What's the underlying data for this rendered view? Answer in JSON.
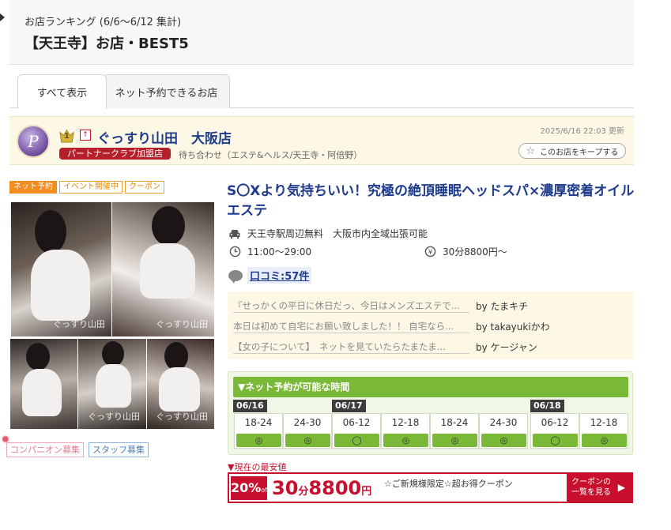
{
  "header": {
    "subtitle": "お店ランキング (6/6～6/12 集計)",
    "title": "【天王寺】お店・BEST5"
  },
  "tabs": [
    {
      "label": "すべて表示",
      "active": true
    },
    {
      "label": "ネット予約できるお店",
      "active": false
    }
  ],
  "shop": {
    "rank": "1",
    "up_mark": "↑",
    "name": "ぐっすり山田　大阪店",
    "partner_label": "パートナークラブ加盟店",
    "category": "待ち合わせ（エステ&ヘルス/天王寺・阿倍野）",
    "updated": "2025/6/16 22:03 更新",
    "keep_label": "このお店をキープする",
    "logo_text": "P",
    "tags": [
      "ネット予約",
      "イベント開催中",
      "クーポン"
    ],
    "watermark": "ぐっすり山田",
    "catch": "S〇Xより気持ちいい！究極の絶頂睡眠ヘッドスパ×濃厚密着オイルエステ",
    "access": "天王寺駅周辺無料　大阪市内全域出張可能",
    "hours": "11:00～29:00",
    "price": "30分8800円～",
    "reviews_link": "口コミ:57件",
    "recruit": [
      "コンパニオン募集",
      "スタッフ募集"
    ]
  },
  "reviews": [
    {
      "quote": "『せっかくの平日に休日だっ、今日はメンズエステで...",
      "by": "by たまキチ"
    },
    {
      "quote": "本日は初めて自宅にお願い致しました！！ 自宅なら...",
      "by": "by takayukiかわ"
    },
    {
      "quote": "【女の子について】　ネットを見ていたらたまたま...",
      "by": "by ケージャン"
    }
  ],
  "booking": {
    "header": "▼ネット予約が可能な時間",
    "dates": [
      "06/16",
      "06/17",
      "06/18"
    ],
    "slots": [
      {
        "time": "18-24",
        "mark": "◎"
      },
      {
        "time": "24-30",
        "mark": "◎"
      },
      {
        "time": "06-12",
        "mark": "◯"
      },
      {
        "time": "12-18",
        "mark": "◎"
      },
      {
        "time": "18-24",
        "mark": "◎"
      },
      {
        "time": "24-30",
        "mark": "◎"
      },
      {
        "time": "06-12",
        "mark": "◯"
      },
      {
        "time": "12-18",
        "mark": "◎"
      }
    ]
  },
  "lowest": {
    "label": "▼現在の最安値",
    "discount_pct": "20%",
    "discount_off": "off",
    "duration": "30",
    "duration_unit": "分",
    "price": "8800",
    "price_unit": "円",
    "coupon_title": "☆ご新規様限定☆超お得クーポン",
    "coupon_btn_line1": "クーポンの",
    "coupon_btn_line2": "一覧を見る",
    "coupon_btn_arrow": "▶"
  },
  "colors": {
    "shop_name": "#1f3b8c",
    "accent_red": "#c8102e",
    "booking_green": "#7ab837",
    "tag_orange": "#f28c1f"
  }
}
